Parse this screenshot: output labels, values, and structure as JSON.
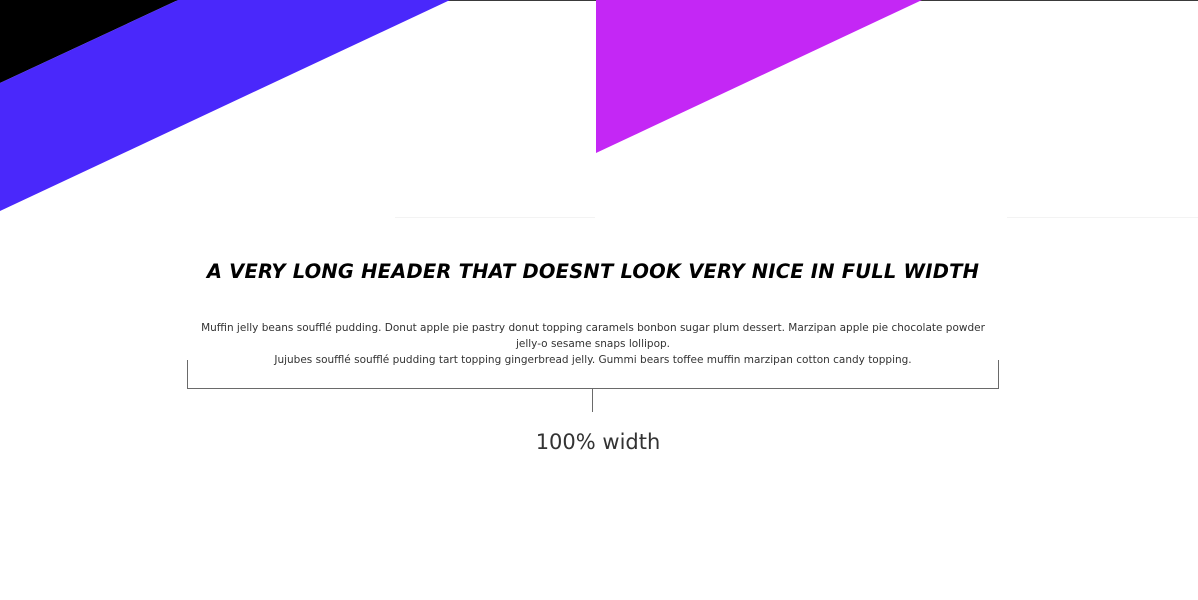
{
  "colors": {
    "black_wedge": "#000000",
    "blue_band": "#4a28fb",
    "purple_triangle": "#c427f5",
    "text_primary": "#000000",
    "text_secondary": "#333333",
    "bracket": "#6a6a6a"
  },
  "section": {
    "title": "A VERY LONG HEADER THAT DOESNT LOOK VERY NICE IN FULL WIDTH",
    "paragraph_1": "Muffin jelly beans soufflé pudding. Donut apple pie pastry donut topping caramels bonbon sugar plum dessert. Marzipan apple pie chocolate powder jelly-o sesame snaps lollipop.",
    "paragraph_2": "Jujubes soufflé soufflé pudding tart topping gingerbread jelly. Gummi bears toffee muffin marzipan cotton candy topping."
  },
  "annotation": {
    "label": "100% width"
  }
}
